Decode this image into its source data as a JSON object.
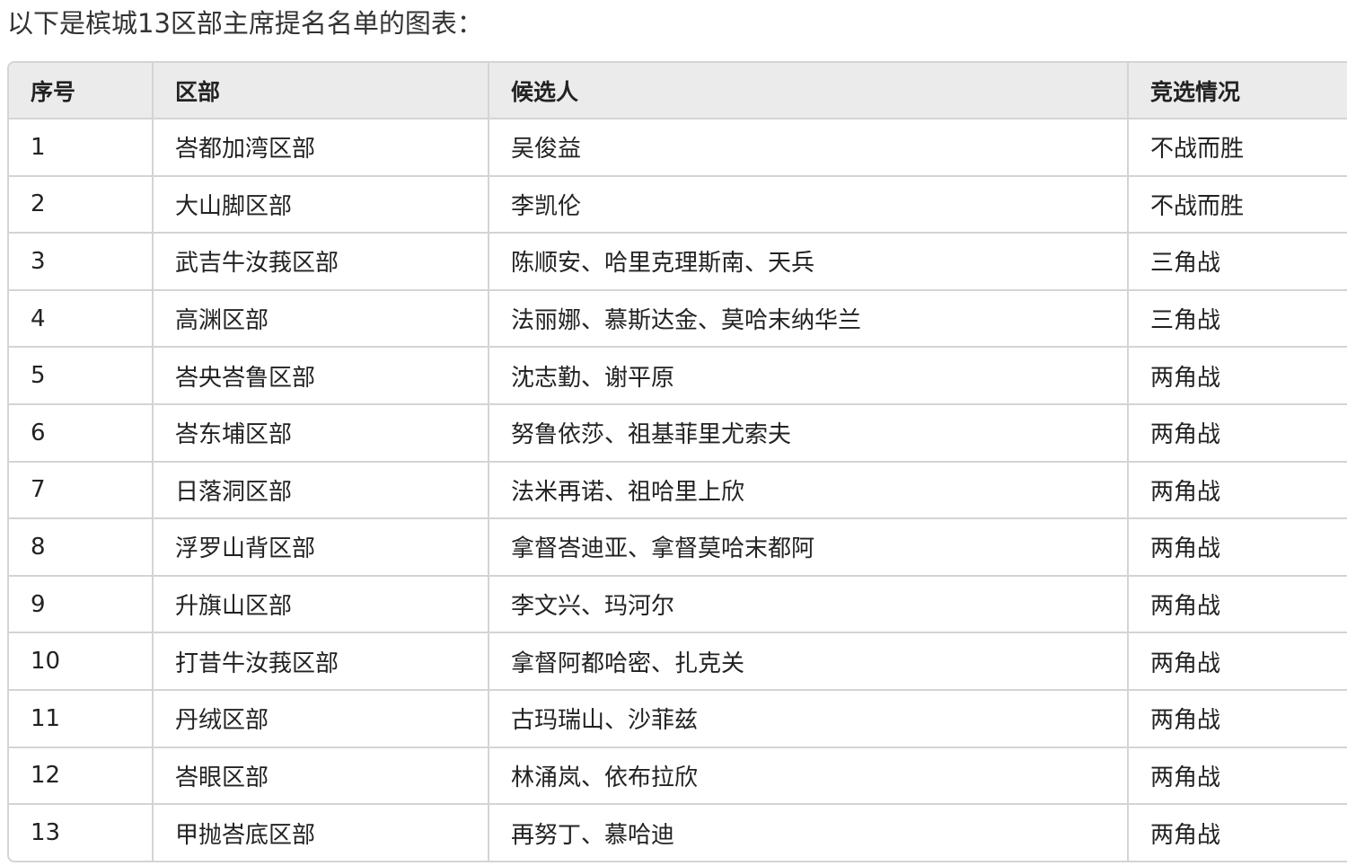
{
  "intro": "以下是槟城13区部主席提名名单的图表：",
  "table": {
    "headers": [
      "序号",
      "区部",
      "候选人",
      "竞选情况"
    ],
    "rows": [
      [
        "1",
        "峇都加湾区部",
        "吴俊益",
        "不战而胜"
      ],
      [
        "2",
        "大山脚区部",
        "李凯伦",
        "不战而胜"
      ],
      [
        "3",
        "武吉牛汝莪区部",
        "陈顺安、哈里克理斯南、天兵",
        "三角战"
      ],
      [
        "4",
        "高渊区部",
        "法丽娜、慕斯达金、莫哈末纳华兰",
        "三角战"
      ],
      [
        "5",
        "峇央峇鲁区部",
        "沈志勤、谢平原",
        "两角战"
      ],
      [
        "6",
        "峇东埔区部",
        "努鲁依莎、祖基菲里尤索夫",
        "两角战"
      ],
      [
        "7",
        "日落洞区部",
        "法米再诺、祖哈里上欣",
        "两角战"
      ],
      [
        "8",
        "浮罗山背区部",
        "拿督峇迪亚、拿督莫哈末都阿",
        "两角战"
      ],
      [
        "9",
        "升旗山区部",
        "李文兴、玛河尔",
        "两角战"
      ],
      [
        "10",
        "打昔牛汝莪区部",
        "拿督阿都哈密、扎克关",
        "两角战"
      ],
      [
        "11",
        "丹绒区部",
        "古玛瑞山、沙菲兹",
        "两角战"
      ],
      [
        "12",
        "峇眼区部",
        "林涌岚、依布拉欣",
        "两角战"
      ],
      [
        "13",
        "甲抛峇底区部",
        "再努丁、慕哈迪",
        "两角战"
      ]
    ]
  }
}
